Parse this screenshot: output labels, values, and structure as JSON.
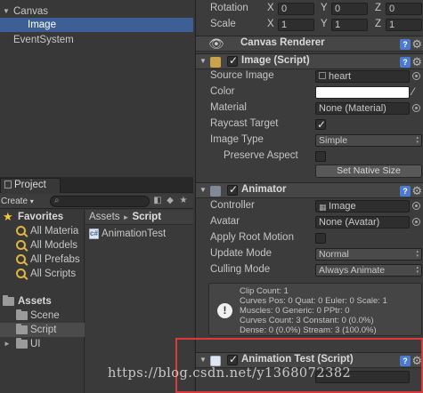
{
  "hierarchy": {
    "items": [
      {
        "label": "Canvas"
      },
      {
        "label": "Image"
      },
      {
        "label": "EventSystem"
      }
    ]
  },
  "project": {
    "tab_label": "Project",
    "create_label": "Create",
    "create_arrow": "▾",
    "favorites": {
      "label": "Favorites",
      "items": [
        "All Materia",
        "All Models",
        "All Prefabs",
        "All Scripts"
      ]
    },
    "assets": {
      "label": "Assets",
      "folders": [
        "Scene",
        "Script",
        "UI"
      ]
    },
    "breadcrumb": [
      "Assets",
      "Script"
    ],
    "breadcrumb_sep": "►",
    "files": [
      "AnimationTest"
    ]
  },
  "inspector": {
    "rotation": {
      "label": "Rotation",
      "x_label": "X",
      "x": "0",
      "y_label": "Y",
      "y": "0",
      "z_label": "Z",
      "z": "0"
    },
    "scale": {
      "label": "Scale",
      "x_label": "X",
      "x": "1",
      "y_label": "Y",
      "y": "1",
      "z_label": "Z",
      "z": "1"
    },
    "canvas_renderer": {
      "title": "Canvas Renderer"
    },
    "image": {
      "title": "Image (Script)",
      "source_image_label": "Source Image",
      "source_image_value": "heart",
      "color_label": "Color",
      "material_label": "Material",
      "material_value": "None (Material)",
      "raycast_label": "Raycast Target",
      "image_type_label": "Image Type",
      "image_type_value": "Simple",
      "preserve_aspect_label": "Preserve Aspect",
      "native_size_button": "Set Native Size"
    },
    "animator": {
      "title": "Animator",
      "controller_label": "Controller",
      "controller_value": "Image",
      "avatar_label": "Avatar",
      "avatar_value": "None (Avatar)",
      "apply_root_motion_label": "Apply Root Motion",
      "update_mode_label": "Update Mode",
      "update_mode_value": "Normal",
      "culling_mode_label": "Culling Mode",
      "culling_mode_value": "Always Animate",
      "info_lines": [
        "Clip Count: 1",
        "Curves Pos: 0 Quat: 0 Euler: 0 Scale: 1",
        "Muscles: 0 Generic: 0 PPtr: 0",
        "Curves Count: 3 Constant: 0 (0.0%)",
        "Dense: 0 (0.0%) Stream: 3 (100.0%)"
      ]
    },
    "animation_test": {
      "title": "Animation Test (Script)"
    }
  },
  "watermark": "https://blog.csdn.net/y1368072382",
  "colors": {
    "selection": "#3e5f96",
    "highlight_box": "#d93a3a",
    "help_icon": "#4a7bd0"
  }
}
